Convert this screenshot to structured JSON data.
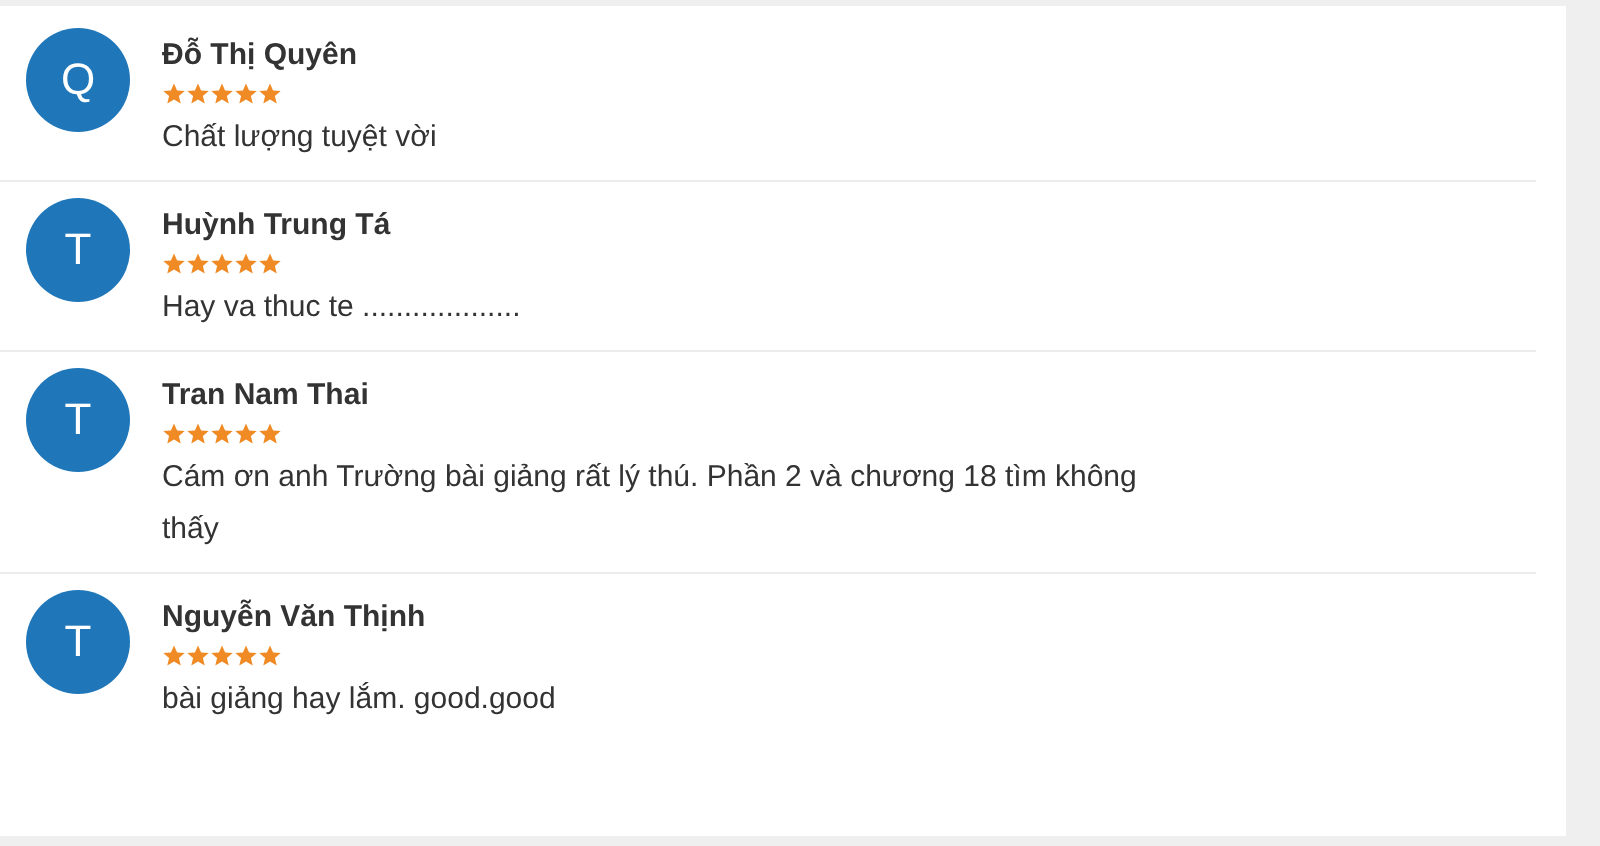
{
  "reviews": [
    {
      "initial": "Q",
      "name": "Đỗ Thị Quyên",
      "stars": 5,
      "comment": "Chất lượng tuyệt vời"
    },
    {
      "initial": "T",
      "name": "Huỳnh Trung Tá",
      "stars": 5,
      "comment": "Hay va thuc te ..................."
    },
    {
      "initial": "T",
      "name": "Tran Nam Thai",
      "stars": 5,
      "comment": "Cám ơn anh Trường bài giảng rất lý thú. Phần 2 và chương 18 tìm không thấy"
    },
    {
      "initial": "T",
      "name": "Nguyễn Văn Thịnh",
      "stars": 5,
      "comment": "bài giảng hay lắm. good.good"
    }
  ]
}
